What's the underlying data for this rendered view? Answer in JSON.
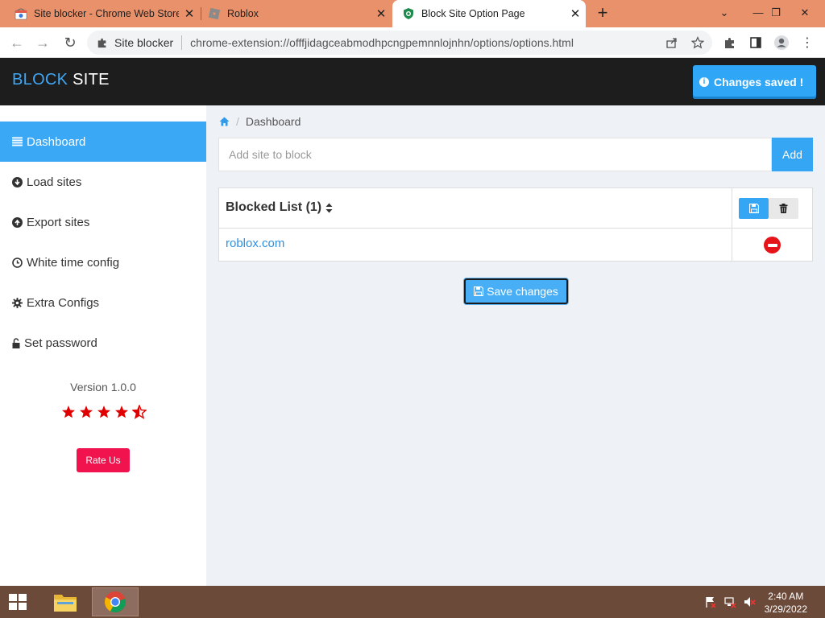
{
  "browser": {
    "tabs": [
      {
        "title": "Site blocker - Chrome Web Store",
        "active": false
      },
      {
        "title": "Roblox",
        "active": false
      },
      {
        "title": "Block Site Option Page",
        "active": true
      }
    ],
    "omnibox": {
      "chip": "Site blocker",
      "url": "chrome-extension://offfjidagceabmodhpcngpemnnlojnhn/options/options.html"
    }
  },
  "app": {
    "brand_part1": "BLOCK",
    "brand_part2": " SITE",
    "toast": "Changes saved !"
  },
  "sidebar": {
    "items": [
      {
        "label": "Dashboard",
        "icon": "list-icon",
        "active": true
      },
      {
        "label": "Load sites",
        "icon": "download-circle-icon",
        "active": false
      },
      {
        "label": "Export sites",
        "icon": "upload-circle-icon",
        "active": false
      },
      {
        "label": "White time config",
        "icon": "clock-icon",
        "active": false
      },
      {
        "label": "Extra Configs",
        "icon": "gear-icon",
        "active": false
      },
      {
        "label": "Set password",
        "icon": "unlock-icon",
        "active": false
      }
    ],
    "version": "Version 1.0.0",
    "rating": 4.5,
    "rate_label": "Rate Us"
  },
  "main": {
    "breadcrumb": {
      "current": "Dashboard"
    },
    "add": {
      "placeholder": "Add site to block",
      "button": "Add"
    },
    "table": {
      "title": "Blocked List (1)",
      "rows": [
        {
          "site": "roblox.com"
        }
      ]
    },
    "save_button": "Save changes"
  },
  "taskbar": {
    "time": "2:40 AM",
    "date": "3/29/2022"
  },
  "colors": {
    "accent": "#35a6f4",
    "tabstrip": "#e9916b",
    "header": "#1d1d1d",
    "danger": "#e5131a",
    "rate": "#f0134d",
    "star": "#e00000"
  }
}
